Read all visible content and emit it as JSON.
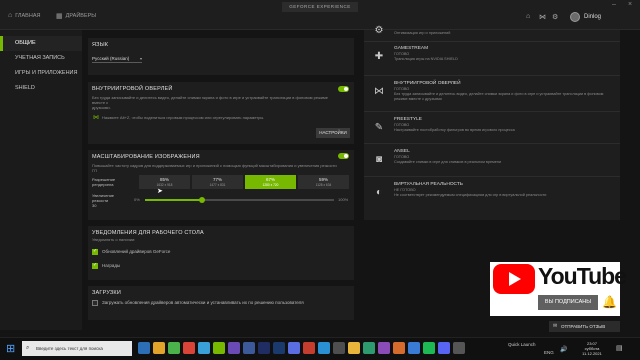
{
  "titlebar": {
    "brand": "GEFORCE EXPERIENCE",
    "nav_home": "ГЛАВНАЯ",
    "nav_drivers": "ДРАЙВЕРЫ",
    "user_name": "Dinlog"
  },
  "sidebar": {
    "items": [
      {
        "label": "ОБЩИЕ",
        "active": true
      },
      {
        "label": "УЧЕТНАЯ ЗАПИСЬ"
      },
      {
        "label": "ИГРЫ И ПРИЛОЖЕНИЯ"
      },
      {
        "label": "SHIELD"
      }
    ]
  },
  "language": {
    "title": "ЯЗЫК",
    "value": "Русский (Russian)"
  },
  "overlay": {
    "title": "ВНУТРИИГРОВОЙ ОВЕРЛЕЙ",
    "desc1": "Без труда записывайте и делитесь видео, делайте снимки экрана и фото в игре и устраивайте трансляции в фоновом режиме вместе с",
    "desc2": "друзьями.",
    "hint": "Нажмите Alt+Z, чтобы поделиться игровым процессом или отрегулировать параметры.",
    "settings_label": "НАСТРОЙКИ"
  },
  "scaling": {
    "title": "МАСШТАБИРОВАНИЕ ИЗОБРАЖЕНИЯ",
    "desc": "Повышайте частоту кадров для поддерживаемых игр и приложений с помощью функций масштабирования и увеличения резкости ГП",
    "res_label1": "Разрешение",
    "res_label2": "рендеринга",
    "options": [
      {
        "pct": "85%",
        "res": "1632 x 918"
      },
      {
        "pct": "77%",
        "res": "1477 x 831"
      },
      {
        "pct": "67%",
        "res": "1280 x 720"
      },
      {
        "pct": "59%",
        "res": "1128 x 634"
      }
    ],
    "selected_index": 2,
    "sharp_label1": "Увеличение",
    "sharp_label2": "резкости",
    "sharp_value": "30",
    "slider_min": "0%",
    "slider_max": "100%",
    "slider_value": 0.3
  },
  "notifications": {
    "title": "УВЕДОМЛЕНИЯ ДЛЯ РАБОЧЕГО СТОЛА",
    "subtitle": "Уведомлять о наличии:",
    "items": [
      {
        "label": "Обновлений драйверов GeForce",
        "checked": true
      },
      {
        "label": "Награды",
        "checked": true
      }
    ]
  },
  "downloads": {
    "title": "ЗАГРУЗКИ",
    "item_label": "Загружать обновления драйверов автоматически и устанавливать их по решению пользователя",
    "checked": false
  },
  "features": [
    {
      "name": "",
      "status": "",
      "desc": "Оптимизация игр и приложений",
      "icon": "gear-icon"
    },
    {
      "name": "GAMESTREAM",
      "status": "ГОТОВО",
      "desc": "Трансляция игры на NVIDIA SHIELD",
      "icon": "gamepad-icon"
    },
    {
      "name": "ВНУТРИИГРОВОЙ ОВЕРЛЕЙ",
      "status": "ГОТОВО",
      "desc": "Без труда записывайте и делитесь видео, делайте снимки экрана и фото в игре и устраивайте трансляции в фоновом режиме вместе с друзьями",
      "icon": "share-icon"
    },
    {
      "name": "FREESTYLE",
      "status": "ГОТОВО",
      "desc": "Настраивайте постобработку фильтров во время игрового процесса",
      "icon": "edit-icon"
    },
    {
      "name": "ANSEL",
      "status": "ГОТОВО",
      "desc": "Создавайте снимки в игре для снимков в реальном времени",
      "icon": "camera-icon"
    },
    {
      "name": "ВИРТУАЛЬНАЯ РЕАЛЬНОСТЬ",
      "status": "НЕ ГОТОВО",
      "desc": "Не соответствует рекомендуемым спецификациям для игр в виртуальной реальности",
      "icon": "vr-icon"
    }
  ],
  "youtube": {
    "word": "YouTube",
    "subscribed": "ВЫ ПОДПИСАНЫ"
  },
  "send_feedback": "ОТПРАВИТЬ ОТЗЫВ",
  "taskbar": {
    "search_placeholder": "Введите здесь текст для поиска",
    "quick_launch": "Quick Launch",
    "lang": "ENG",
    "time": "23:07",
    "day": "суббота",
    "date": "11.12.2021",
    "colors": {
      "accent": "#76b900",
      "youtube_red": "#ff0000"
    }
  }
}
